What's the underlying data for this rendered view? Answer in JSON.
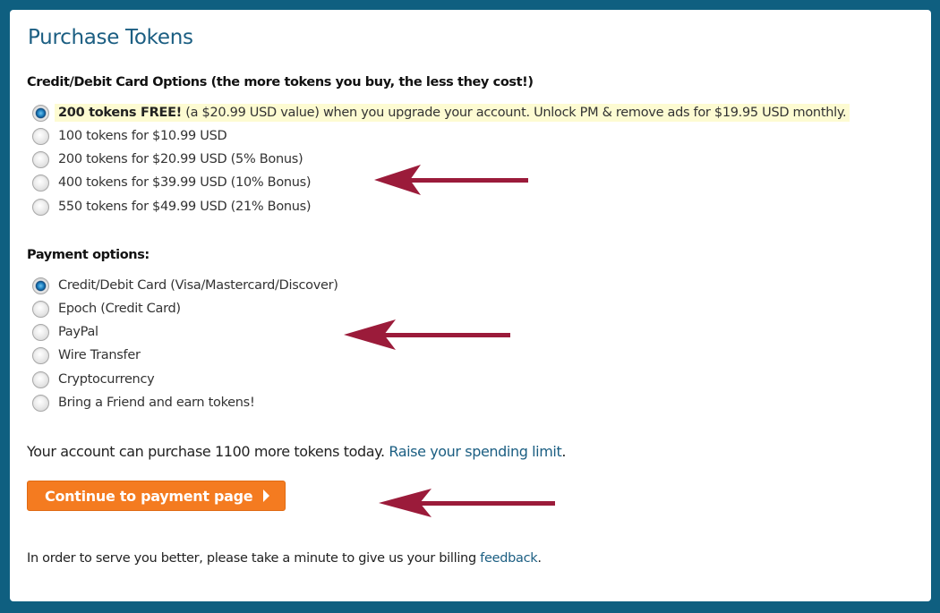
{
  "page": {
    "title": "Purchase Tokens"
  },
  "card_options": {
    "label": "Credit/Debit Card Options (the more tokens you buy, the less they cost!)",
    "promo": {
      "bold": "200 tokens FREE!",
      "rest": " (a $20.99 USD value) when you upgrade your account. Unlock PM & remove ads for $19.95 USD monthly.",
      "checked": true,
      "highlight_color": "#fdfbd2"
    },
    "items": [
      {
        "label": "100 tokens for $10.99 USD",
        "checked": false
      },
      {
        "label": "200 tokens for $20.99 USD (5% Bonus)",
        "checked": false
      },
      {
        "label": "400 tokens for $39.99 USD (10% Bonus)",
        "checked": false
      },
      {
        "label": "550 tokens for $49.99 USD (21% Bonus)",
        "checked": false
      }
    ]
  },
  "payment_options": {
    "label": "Payment options:",
    "items": [
      {
        "label": "Credit/Debit Card (Visa/Mastercard/Discover)",
        "checked": true
      },
      {
        "label": "Epoch (Credit Card)",
        "checked": false
      },
      {
        "label": "PayPal",
        "checked": false
      },
      {
        "label": "Wire Transfer",
        "checked": false
      },
      {
        "label": "Cryptocurrency",
        "checked": false
      },
      {
        "label": "Bring a Friend and earn tokens!",
        "checked": false
      }
    ]
  },
  "limit": {
    "text": "Your account can purchase 1100 more tokens today. ",
    "link": "Raise your spending limit",
    "suffix": "."
  },
  "continue_button": {
    "label": "Continue to payment page",
    "icon": "caret-right-icon"
  },
  "feedback": {
    "text": "In order to serve you better, please take a minute to give us your billing ",
    "link": "feedback",
    "suffix": "."
  },
  "annotations": {
    "arrow_color": "#9b1b3a",
    "count": 3
  },
  "colors": {
    "frame": "#0f5f80",
    "title": "#1b5e82",
    "link": "#1b5e82",
    "button": "#f47b20"
  }
}
